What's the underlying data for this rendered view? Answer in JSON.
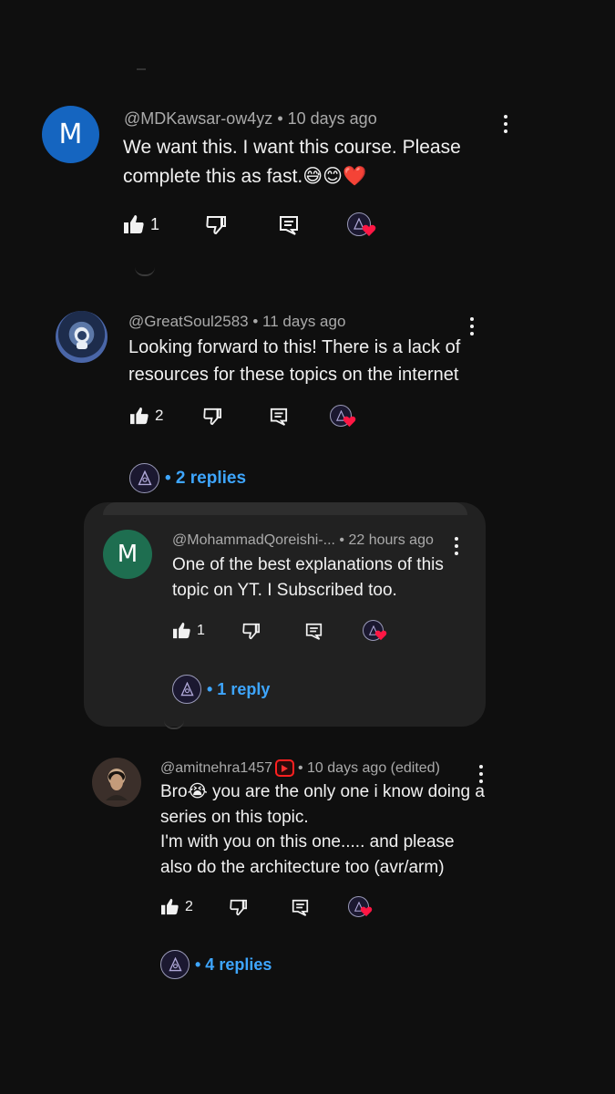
{
  "comments": [
    {
      "author": "@MDKawsar-ow4yz",
      "time": "• 10 days ago",
      "avatar_letter": "M",
      "avatar_color": "#1565c0",
      "text": "We want this. I want this course. Please\ncomplete this as fast.😅😊❤️",
      "likes": "1"
    },
    {
      "author": "@GreatSoul2583",
      "time": "• 11 days ago",
      "avatar_icon": "astronaut-avatar",
      "text": "Looking forward to this! There is a lack of\nresources for these topics on the internet",
      "likes": "2",
      "replies_label": "• 2 replies"
    },
    {
      "author": "@MohammadQoreishi-...",
      "time": "• 22 hours ago",
      "avatar_letter": "M",
      "avatar_color": "#1e6e50",
      "text": "One of the best explanations of this\ntopic on YT. I Subscribed too.",
      "likes": "1",
      "replies_label": "• 1 reply"
    },
    {
      "author": "@amitnehra1457",
      "time": "• 10 days ago (edited)",
      "avatar_icon": "portrait-avatar",
      "badge_icon": "youtube-badge-icon",
      "text": "Bro😭 you are the only one i know doing a\nseries on this topic.\nI'm with you on this one..... and please\nalso do the architecture too (avr/arm)",
      "likes": "2",
      "replies_label": "• 4 replies"
    }
  ],
  "colors": {
    "background": "#0f0f0f",
    "panel": "#212121",
    "link": "#3ea6ff",
    "meta": "#aaaaaa",
    "heart": "#ff1744"
  }
}
